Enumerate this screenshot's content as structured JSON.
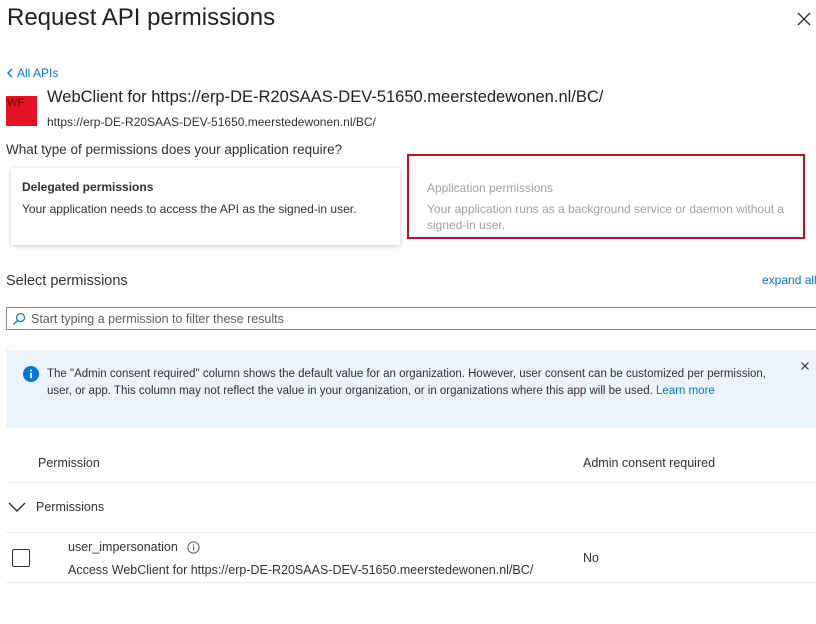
{
  "panel": {
    "title": "Request API permissions"
  },
  "nav": {
    "back_label": "All APIs"
  },
  "api": {
    "badge": "WF",
    "name": "WebClient for https://erp-DE-R20SAAS-DEV-51650.meerstedewonen.nl/BC/",
    "url": "https://erp-DE-R20SAAS-DEV-51650.meerstedewonen.nl/BC/"
  },
  "permission_type": {
    "question": "What type of permissions does your application require?",
    "delegated": {
      "title": "Delegated permissions",
      "description": "Your application needs to access the API as the signed-in user."
    },
    "application": {
      "title": "Application permissions",
      "description": "Your application runs as a background service or daemon without a signed-in user."
    }
  },
  "select": {
    "heading": "Select permissions",
    "expand_all": "expand all",
    "search_placeholder": "Start typing a permission to filter these results"
  },
  "info_banner": {
    "text": "The \"Admin consent required\" column shows the default value for an organization. However, user consent can be customized per permission, user, or app. This column may not reflect the value in your organization, or in organizations where this app will be used.",
    "link": "Learn more"
  },
  "table": {
    "columns": [
      "Permission",
      "Admin consent required"
    ],
    "group": "Permissions",
    "rows": [
      {
        "name": "user_impersonation",
        "description": "Access WebClient for https://erp-DE-R20SAAS-DEV-51650.meerstedewonen.nl/BC/",
        "admin_consent": "No"
      }
    ]
  },
  "colors": {
    "accent": "#0078d4",
    "highlight_border": "#c50f1f",
    "badge": "#e81123",
    "banner_bg": "#ebf3fc"
  },
  "icons": {
    "close": "close-icon",
    "back": "chevron-left-icon",
    "search": "search-icon",
    "info": "info-icon",
    "group": "chevron-down-icon",
    "permission_info": "info-circle-icon"
  }
}
